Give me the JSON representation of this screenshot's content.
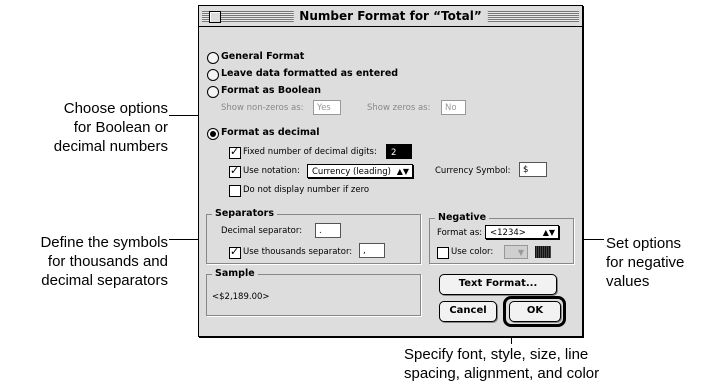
{
  "dialog": {
    "title": "Number Format for “Total”",
    "options": {
      "general": "General Format",
      "leave_as_entered": "Leave data formatted as entered",
      "boolean": "Format as Boolean",
      "decimal": "Format as decimal"
    },
    "boolean": {
      "nonzero_label": "Show non-zeros as:",
      "nonzero_value": "Yes",
      "zero_label": "Show zeros as:",
      "zero_value": "No"
    },
    "decimal": {
      "fixed_label": "Fixed number of decimal digits:",
      "fixed_value": "2",
      "notation_label": "Use notation:",
      "notation_value": "Currency (leading)",
      "currency_label": "Currency Symbol:",
      "currency_value": "$",
      "hide_zero_label": "Do not display number if zero"
    },
    "separators": {
      "title": "Separators",
      "decimal_label": "Decimal separator:",
      "decimal_value": ".",
      "thousands_label": "Use thousands separator:",
      "thousands_value": ","
    },
    "negative": {
      "title": "Negative",
      "format_label": "Format as:",
      "format_value": "<1234>",
      "color_label": "Use color:"
    },
    "sample": {
      "title": "Sample",
      "value": "<$2,189.00>"
    },
    "buttons": {
      "text_format": "Text Format...",
      "cancel": "Cancel",
      "ok": "OK"
    },
    "selected_option": "decimal",
    "checked": {
      "fixed_digits": true,
      "use_notation": true,
      "hide_zero": false,
      "thousands": true,
      "use_color": false
    },
    "colors": {
      "dialog_bg": "#dddddd",
      "color_swatch": "#222222"
    }
  },
  "callouts": {
    "boolean_decimal": "Choose options\nfor Boolean or\ndecimal numbers",
    "separators": "Define the symbols\nfor thousands and\ndecimal separators",
    "negative": "Set options\nfor negative\nvalues",
    "text_format": "Specify font, style, size, line\nspacing, alignment, and color"
  }
}
